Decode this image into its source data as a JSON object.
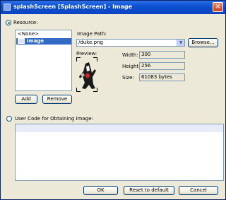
{
  "window": {
    "title": "splashScreen [SplashScreen] - Image"
  },
  "resource": {
    "radio_label": "Resource:",
    "list_items": [
      "<None>",
      "image"
    ],
    "add_label": "Add",
    "remove_label": "Remove",
    "image_path_label": "Image Path:",
    "image_path_value": "/duke.png",
    "browse_label": "Browse...",
    "preview_label": "Preview:",
    "width_label": "Width:",
    "width_value": "300",
    "height_label": "Height:",
    "height_value": "256",
    "size_label": "Size:",
    "size_value": "61083 bytes"
  },
  "user_code": {
    "radio_label": "User Code for Obtaining Image:"
  },
  "footer": {
    "ok_label": "OK",
    "reset_label": "Reset to default",
    "cancel_label": "Cancel"
  },
  "icons": [
    "app-icon",
    "close-icon",
    "image-icon",
    "chevron-down-icon",
    "duke-mascot-icon"
  ]
}
